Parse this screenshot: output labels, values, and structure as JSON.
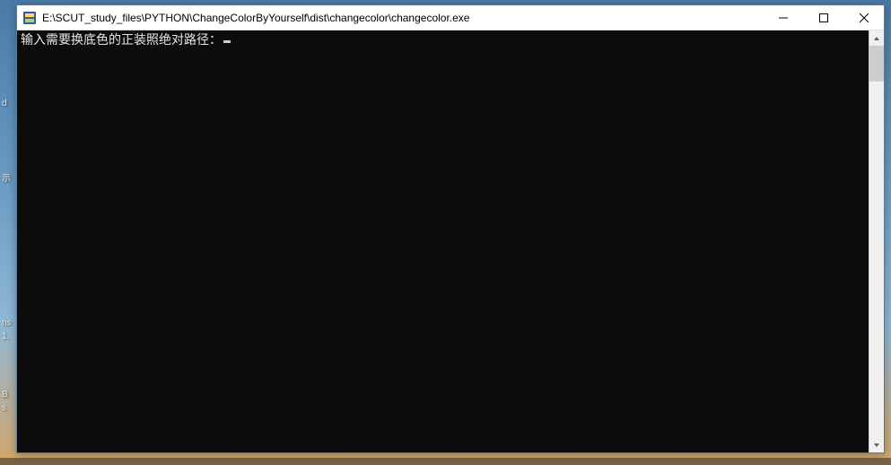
{
  "window": {
    "title": "E:\\SCUT_study_files\\PYTHON\\ChangeColorByYourself\\dist\\changecolor\\changecolor.exe",
    "controls": {
      "minimize": "Minimize",
      "maximize": "Maximize",
      "close": "Close"
    }
  },
  "console": {
    "prompt": "输入需要换底色的正装照绝对路径："
  },
  "desktop_fragments": {
    "f1": "d",
    "f2": "示",
    "f3": "ns",
    "f4": "1.",
    "f5": "B",
    "f6": "s"
  }
}
